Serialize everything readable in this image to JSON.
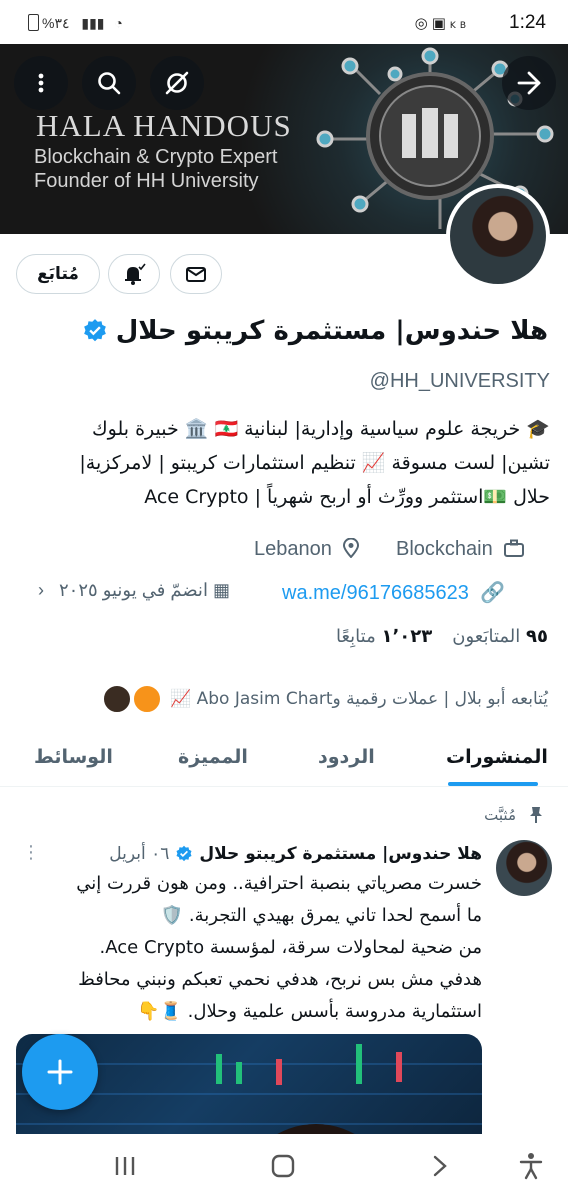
{
  "status_bar": {
    "time": "1:24",
    "battery": "%٣٤",
    "kb_label": "KB"
  },
  "banner": {
    "brand": "HALA HANDOUS",
    "line1": "Blockchain & Crypto Expert",
    "line2": "Founder of HH University"
  },
  "profile": {
    "follow_button": "مُتابَع",
    "display_name": "هلا حندوس| مستثمرة كريبتو حلال",
    "handle": "@HH_UNIVERSITY",
    "bio_lines": [
      "🎓 خريجة علوم سياسية وإدارية| لبنانية 🇱🇧 🏛️ خبيرة بلوك",
      "تشين| لست مسوقة 📈 تنظيم استثمارات كريبتو | لامركزية|",
      "حلال 💵استثمر وورِّث أو اربح شهرياً | Ace Crypto"
    ],
    "location": "Lebanon",
    "category": "Blockchain",
    "link": "wa.me/96176685623",
    "joined": "انضمّ في يونيو ٢٠٢٥",
    "following_count": "١٬٠٢٣",
    "following_label": "متابِعًا",
    "followers_count": "٩٥",
    "followers_label": "المتابَعون",
    "followed_by": "يُتابعه أبو بلال | عملات رقمية وAbo Jasim Chart 📈"
  },
  "tabs": [
    {
      "label": "المنشورات",
      "active": true
    },
    {
      "label": "الردود",
      "active": false
    },
    {
      "label": "المميزة",
      "active": false
    },
    {
      "label": "الوسائط",
      "active": false
    }
  ],
  "tweet": {
    "pinned_label": "مُثبَّت",
    "author": "هلا حندوس| مستثمرة كريبتو حلال",
    "date": "٠٦ أبريل",
    "lines": [
      "خسرت مصرياتي بنصبة احترافية.. ومن هون قررت إني",
      "ما أسمح لحدا تاني يمرق بهيدي التجربة. 🛡️",
      "من ضحية لمحاولات سرقة، لمؤسسة Ace Crypto.",
      "هدفي مش بس نربح، هدفي نحمي تعبكم ونبني محافظ",
      "استثمارية مدروسة بأسس علمية وحلال. 🧵👇"
    ]
  },
  "colors": {
    "accent": "#1d9bf0",
    "text": "#0f1419",
    "muted": "#536471"
  }
}
